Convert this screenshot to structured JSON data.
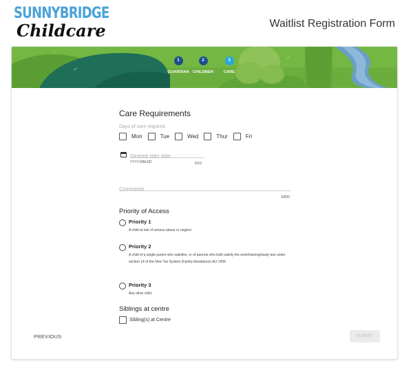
{
  "brand": {
    "logo_top": "SUNNYBRIDGE",
    "logo_bottom": "Childcare"
  },
  "header": {
    "title": "Waitlist Registration Form"
  },
  "steps": [
    {
      "number": "1",
      "label": "GUARDIAN",
      "state": "completed",
      "color": "#1f4e8c"
    },
    {
      "number": "2",
      "label": "CHILDREN",
      "state": "completed",
      "color": "#1f4e8c"
    },
    {
      "number": "3",
      "label": "CARE",
      "state": "active",
      "color": "#29a8e0"
    }
  ],
  "care": {
    "title": "Care Requirements",
    "days_label": "Days of care required",
    "days": [
      "Mon",
      "Tue",
      "Wed",
      "Thur",
      "Fri"
    ],
    "start_date": {
      "placeholder": "Desired start date",
      "format": "YYYY-MM-DD",
      "count": "0/10"
    },
    "comments": {
      "placeholder": "Comments",
      "count": "0/500"
    }
  },
  "priority": {
    "title": "Priority of Access",
    "options": [
      {
        "title": "Priority 1",
        "desc": "A child at risk of serious abuse or neglect"
      },
      {
        "title": "Priority 2",
        "desc": "A child of a single parent who satisfies, or of parents who both satisfy the work/training/study test under section 14 of the New Tax System (Family Assistance) Act 1999"
      },
      {
        "title": "Priority 3",
        "desc": "Any other child"
      }
    ]
  },
  "siblings": {
    "title": "Siblings at centre",
    "checkbox_label": "Sibling(s) at Centre"
  },
  "nav": {
    "previous": "PREVIOUS",
    "submit": "SUBMIT"
  },
  "colors": {
    "banner_green": "#6cae3e",
    "banner_dark": "#1f6f58",
    "accent_blue": "#29a8e0",
    "step_navy": "#1f4e8c"
  }
}
